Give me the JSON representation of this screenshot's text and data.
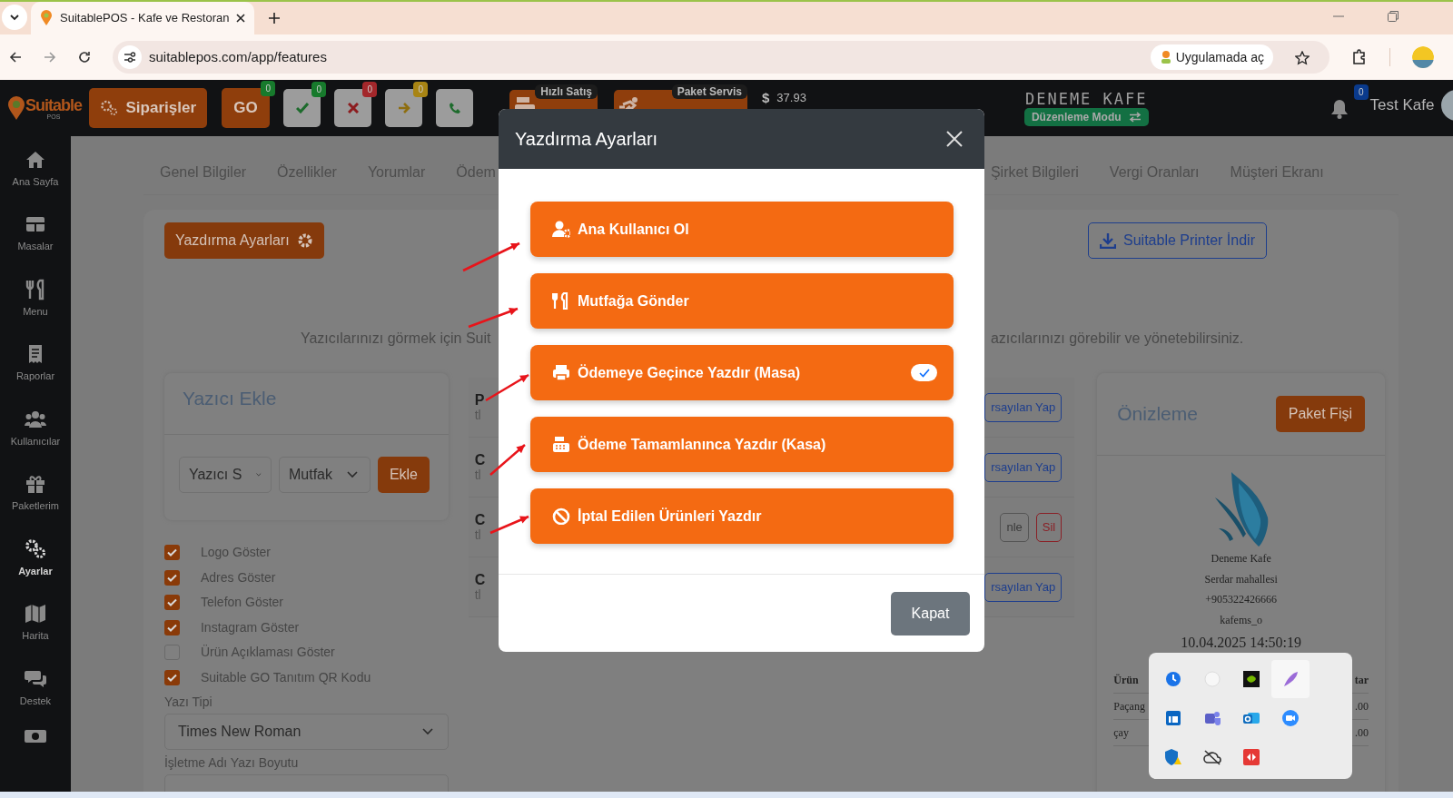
{
  "browser": {
    "tab_title": "SuitablePOS - Kafe ve Restoran",
    "url": "suitablepos.com/app/features",
    "open_in_app": "Uygulamada aç"
  },
  "header": {
    "logo": "Suitable",
    "logo_sub": "POS",
    "orders_button": "Siparişler",
    "status_buttons": [
      {
        "kind": "text",
        "label": "GO",
        "count": "0",
        "color": "#177a2c"
      },
      {
        "kind": "check",
        "count": "0",
        "color": "#177a2c"
      },
      {
        "kind": "cancel",
        "count": "0",
        "color": "#a3272b"
      },
      {
        "kind": "forward",
        "count": "0",
        "color": "#a88414"
      },
      {
        "kind": "phone"
      }
    ],
    "quick_buttons": [
      {
        "kind": "register",
        "tag": "Hızlı Satış"
      },
      {
        "kind": "delivery",
        "tag": "Paket Servis"
      }
    ],
    "balance_symbol": "$",
    "balance": "37.93",
    "cafe_name": "DENEME KAFE",
    "mode_badge": "Düzenleme Modu",
    "notifications": "0",
    "user": "Test Kafe"
  },
  "sidebar": {
    "items": [
      {
        "label": "Ana Sayfa",
        "selected": false
      },
      {
        "label": "Masalar",
        "selected": false
      },
      {
        "label": "Menu",
        "selected": false
      },
      {
        "label": "Raporlar",
        "selected": false
      },
      {
        "label": "Kullanıcılar",
        "selected": false
      },
      {
        "label": "Paketlerim",
        "selected": false
      },
      {
        "label": "Ayarlar",
        "selected": true
      },
      {
        "label": "Harita",
        "selected": false
      },
      {
        "label": "Destek",
        "selected": false
      }
    ]
  },
  "tabs": [
    "Genel Bilgiler",
    "Özellikler",
    "Yorumlar",
    "Ödem",
    "Şirket Bilgileri",
    "Vergi Oranları",
    "Müşteri Ekranı"
  ],
  "print_settings_button": "Yazdırma Ayarları",
  "download_button": "Suitable Printer İndir",
  "info_text_left": "Yazıcılarınızı görmek için Suit",
  "info_text_right": "azıcılarınızı görebilir ve yönetebilirsiniz.",
  "add_printer": {
    "title": "Yazıcı Ekle",
    "printer_select": "Yazıcı S",
    "type_select": "Mutfak",
    "add_button": "Ekle"
  },
  "options": [
    {
      "label": "Logo Göster",
      "checked": true
    },
    {
      "label": "Adres Göster",
      "checked": true
    },
    {
      "label": "Telefon Göster",
      "checked": true
    },
    {
      "label": "Instagram Göster",
      "checked": true
    },
    {
      "label": "Ürün Açıklaması Göster",
      "checked": false
    },
    {
      "label": "Suitable GO Tanıtım QR Kodu",
      "checked": true
    }
  ],
  "font": {
    "label": "Yazı Tipi",
    "value": "Times New Roman"
  },
  "font_size_label": "İşletme Adı Yazı Boyutu",
  "printers": [
    {
      "title": "P",
      "subtitle": "tl",
      "actions": [
        {
          "kind": "default",
          "label": "rsayılan Yap"
        }
      ]
    },
    {
      "title": "C",
      "subtitle": "tl",
      "actions": [
        {
          "kind": "default",
          "label": "rsayılan Yap"
        }
      ]
    },
    {
      "title": "C",
      "subtitle": "tl",
      "actions": [
        {
          "kind": "edit",
          "label": "nle"
        },
        {
          "kind": "delete",
          "label": "Sil"
        }
      ]
    },
    {
      "title": "C",
      "subtitle": "tl",
      "actions": [
        {
          "kind": "default",
          "label": "rsayılan Yap"
        }
      ]
    }
  ],
  "preview": {
    "title": "Önizleme",
    "button": "Paket Fişi",
    "lines": [
      "Deneme Kafe",
      "Serdar mahallesi",
      "+905322426666",
      "kafems_o"
    ],
    "datetime": "10.04.2025 14:50:19",
    "columns": [
      "Ürün",
      "tar"
    ],
    "rows": [
      [
        "Paçang",
        ".00"
      ],
      [
        "çay",
        ".00"
      ]
    ]
  },
  "modal": {
    "title": "Yazdırma Ayarları",
    "options": [
      {
        "label": "Ana Kullanıcı Ol",
        "checked": false
      },
      {
        "label": "Mutfağa Gönder",
        "checked": false
      },
      {
        "label": "Ödemeye Geçince Yazdır (Masa)",
        "checked": true
      },
      {
        "label": "Ödeme Tamamlanınca Yazdır (Kasa)",
        "checked": false
      },
      {
        "label": "İptal Edilen Ürünleri Yazdır",
        "checked": false
      }
    ],
    "close_button": "Kapat"
  }
}
